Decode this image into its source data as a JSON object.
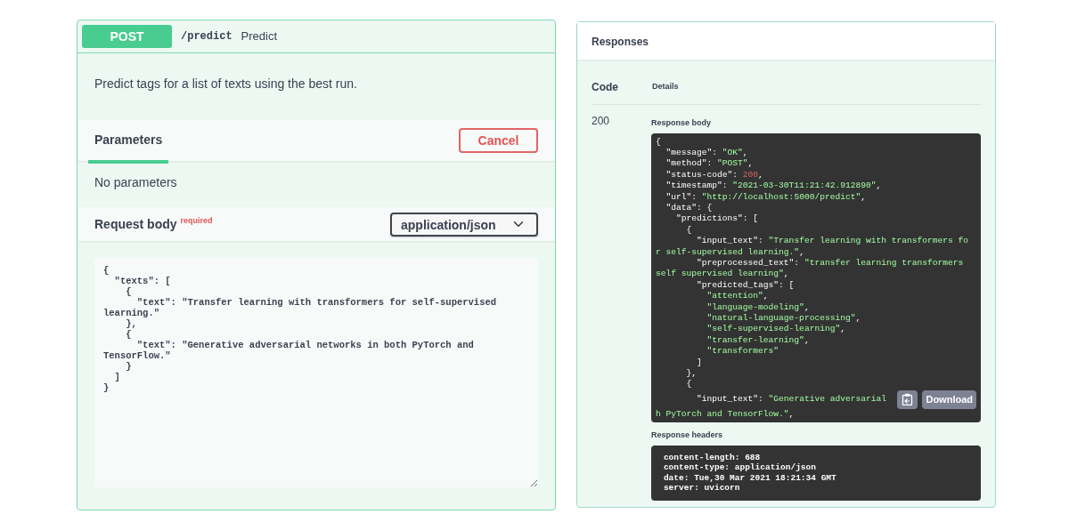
{
  "operation": {
    "method": "POST",
    "path": "/predict",
    "summary": "Predict",
    "description": "Predict tags for a list of texts using the best run.",
    "tabs": [
      {
        "label": "Parameters",
        "selected": true
      }
    ],
    "cancel_button": "Cancel",
    "parameters_note": "No parameters",
    "request_body": {
      "label": "Request body",
      "required_badge": "required",
      "content_type": "application/json",
      "value_lines": [
        "{",
        "  \"texts\": [",
        "    {",
        "      \"text\": \"Transfer learning with transformers for self-supervised",
        "learning.\"",
        "    },",
        "    {",
        "      \"text\": \"Generative adversarial networks in both PyTorch and",
        "TensorFlow.\"",
        "    }",
        "  ]",
        "}"
      ]
    }
  },
  "responses": {
    "title": "Responses",
    "columns": [
      "Code",
      "Details"
    ],
    "rows": [
      {
        "code": "200",
        "body_label": "Response body",
        "body_lines": [
          [
            {
              "text": "{",
              "kind": "plain"
            }
          ],
          [
            {
              "text": "  \"message\": ",
              "kind": "plain"
            },
            {
              "text": "\"OK\"",
              "kind": "string"
            },
            {
              "text": ",",
              "kind": "plain"
            }
          ],
          [
            {
              "text": "  \"method\": ",
              "kind": "plain"
            },
            {
              "text": "\"POST\"",
              "kind": "string"
            },
            {
              "text": ",",
              "kind": "plain"
            }
          ],
          [
            {
              "text": "  \"status-code\": ",
              "kind": "plain"
            },
            {
              "text": "200",
              "kind": "number"
            },
            {
              "text": ",",
              "kind": "plain"
            }
          ],
          [
            {
              "text": "  \"timestamp\": ",
              "kind": "plain"
            },
            {
              "text": "\"2021-03-30T11:21:42.912890\"",
              "kind": "string"
            },
            {
              "text": ",",
              "kind": "plain"
            }
          ],
          [
            {
              "text": "  \"url\": ",
              "kind": "plain"
            },
            {
              "text": "\"http://localhost:5000/predict\"",
              "kind": "string"
            },
            {
              "text": ",",
              "kind": "plain"
            }
          ],
          [
            {
              "text": "  \"data\": {",
              "kind": "plain"
            }
          ],
          [
            {
              "text": "    \"predictions\": [",
              "kind": "plain"
            }
          ],
          [
            {
              "text": "      {",
              "kind": "plain"
            }
          ],
          [
            {
              "text": "        \"input_text\": ",
              "kind": "plain"
            },
            {
              "text": "\"Transfer learning with transformers fo",
              "kind": "string"
            }
          ],
          [
            {
              "text": "r self-supervised learning.\"",
              "kind": "string"
            },
            {
              "text": ",",
              "kind": "plain"
            }
          ],
          [
            {
              "text": "        \"preprocessed_text\": ",
              "kind": "plain"
            },
            {
              "text": "\"transfer learning transformers",
              "kind": "string"
            }
          ],
          [
            {
              "text": "self supervised learning\"",
              "kind": "string"
            },
            {
              "text": ",",
              "kind": "plain"
            }
          ],
          [
            {
              "text": "        \"predicted_tags\": [",
              "kind": "plain"
            }
          ],
          [
            {
              "text": "          \"attention\"",
              "kind": "string"
            },
            {
              "text": ",",
              "kind": "plain"
            }
          ],
          [
            {
              "text": "          \"language-modeling\"",
              "kind": "string"
            },
            {
              "text": ",",
              "kind": "plain"
            }
          ],
          [
            {
              "text": "          \"natural-language-processing\"",
              "kind": "string"
            },
            {
              "text": ",",
              "kind": "plain"
            }
          ],
          [
            {
              "text": "          \"self-supervised-learning\"",
              "kind": "string"
            },
            {
              "text": ",",
              "kind": "plain"
            }
          ],
          [
            {
              "text": "          \"transfer-learning\"",
              "kind": "string"
            },
            {
              "text": ",",
              "kind": "plain"
            }
          ],
          [
            {
              "text": "          \"transformers\"",
              "kind": "string"
            }
          ],
          [
            {
              "text": "        ]",
              "kind": "plain"
            }
          ],
          [
            {
              "text": "      },",
              "kind": "plain"
            }
          ],
          [
            {
              "text": "      {",
              "kind": "plain"
            }
          ],
          [
            {
              "text": "        \"input_text\": ",
              "kind": "plain"
            },
            {
              "text": "\"Generative adversarial",
              "kind": "string"
            }
          ],
          [
            {
              "text": "h PyTorch and TensorFlow.\"",
              "kind": "string"
            },
            {
              "text": ",",
              "kind": "plain"
            }
          ]
        ],
        "download_button": "Download",
        "headers_label": "Response headers",
        "headers_lines": [
          "content-length: 688",
          "content-type: application/json",
          "date: Tue,30 Mar 2021 18:21:34 GMT",
          "server: uvicorn"
        ]
      }
    ]
  }
}
